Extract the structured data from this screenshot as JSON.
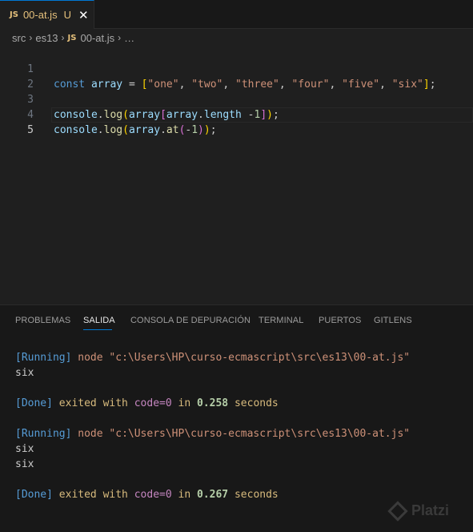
{
  "tab": {
    "badge": "JS",
    "name": "00-at.js",
    "status": "U",
    "close": "✕"
  },
  "breadcrumb": {
    "parts": [
      "src",
      "es13"
    ],
    "badge": "JS",
    "file": "00-at.js",
    "more": "…"
  },
  "editor": {
    "line_numbers": [
      "1",
      "2",
      "3",
      "4",
      "5"
    ],
    "active_line": 5
  },
  "panel": {
    "tabs": [
      "PROBLEMAS",
      "SALIDA",
      "CONSOLA DE DEPURACIÓN",
      "TERMINAL",
      "PUERTOS",
      "GITLENS"
    ],
    "active_tab": "SALIDA",
    "output": {
      "run1_tag": "[Running]",
      "run1_cmd": " node \"c:\\Users\\HP\\curso-ecmascript\\src\\es13\\00-at.js\"",
      "run1_out": "six",
      "done1_tag": "[Done]",
      "done1_a": " exited with ",
      "done1_code": "code=0",
      "done1_b": " in ",
      "done1_time": "0.258",
      "done1_c": " seconds",
      "run2_tag": "[Running]",
      "run2_cmd": " node \"c:\\Users\\HP\\curso-ecmascript\\src\\es13\\00-at.js\"",
      "run2_out1": "six",
      "run2_out2": "six",
      "done2_tag": "[Done]",
      "done2_a": " exited with ",
      "done2_code": "code=0",
      "done2_b": " in ",
      "done2_time": "0.267",
      "done2_c": " seconds"
    }
  },
  "watermark": "Platzi",
  "colors": {
    "accent": "#0078d4",
    "js_badge": "#e5c07b"
  }
}
